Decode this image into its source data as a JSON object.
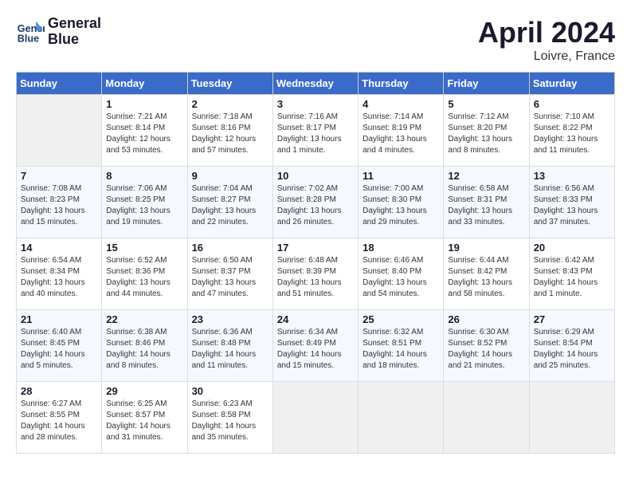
{
  "logo": {
    "line1": "General",
    "line2": "Blue"
  },
  "title": "April 2024",
  "location": "Loivre, France",
  "days_of_week": [
    "Sunday",
    "Monday",
    "Tuesday",
    "Wednesday",
    "Thursday",
    "Friday",
    "Saturday"
  ],
  "weeks": [
    [
      {
        "num": "",
        "empty": true
      },
      {
        "num": "1",
        "sunrise": "7:21 AM",
        "sunset": "8:14 PM",
        "daylight": "12 hours and 53 minutes."
      },
      {
        "num": "2",
        "sunrise": "7:18 AM",
        "sunset": "8:16 PM",
        "daylight": "12 hours and 57 minutes."
      },
      {
        "num": "3",
        "sunrise": "7:16 AM",
        "sunset": "8:17 PM",
        "daylight": "13 hours and 1 minute."
      },
      {
        "num": "4",
        "sunrise": "7:14 AM",
        "sunset": "8:19 PM",
        "daylight": "13 hours and 4 minutes."
      },
      {
        "num": "5",
        "sunrise": "7:12 AM",
        "sunset": "8:20 PM",
        "daylight": "13 hours and 8 minutes."
      },
      {
        "num": "6",
        "sunrise": "7:10 AM",
        "sunset": "8:22 PM",
        "daylight": "13 hours and 11 minutes."
      }
    ],
    [
      {
        "num": "7",
        "sunrise": "7:08 AM",
        "sunset": "8:23 PM",
        "daylight": "13 hours and 15 minutes."
      },
      {
        "num": "8",
        "sunrise": "7:06 AM",
        "sunset": "8:25 PM",
        "daylight": "13 hours and 19 minutes."
      },
      {
        "num": "9",
        "sunrise": "7:04 AM",
        "sunset": "8:27 PM",
        "daylight": "13 hours and 22 minutes."
      },
      {
        "num": "10",
        "sunrise": "7:02 AM",
        "sunset": "8:28 PM",
        "daylight": "13 hours and 26 minutes."
      },
      {
        "num": "11",
        "sunrise": "7:00 AM",
        "sunset": "8:30 PM",
        "daylight": "13 hours and 29 minutes."
      },
      {
        "num": "12",
        "sunrise": "6:58 AM",
        "sunset": "8:31 PM",
        "daylight": "13 hours and 33 minutes."
      },
      {
        "num": "13",
        "sunrise": "6:56 AM",
        "sunset": "8:33 PM",
        "daylight": "13 hours and 37 minutes."
      }
    ],
    [
      {
        "num": "14",
        "sunrise": "6:54 AM",
        "sunset": "8:34 PM",
        "daylight": "13 hours and 40 minutes."
      },
      {
        "num": "15",
        "sunrise": "6:52 AM",
        "sunset": "8:36 PM",
        "daylight": "13 hours and 44 minutes."
      },
      {
        "num": "16",
        "sunrise": "6:50 AM",
        "sunset": "8:37 PM",
        "daylight": "13 hours and 47 minutes."
      },
      {
        "num": "17",
        "sunrise": "6:48 AM",
        "sunset": "8:39 PM",
        "daylight": "13 hours and 51 minutes."
      },
      {
        "num": "18",
        "sunrise": "6:46 AM",
        "sunset": "8:40 PM",
        "daylight": "13 hours and 54 minutes."
      },
      {
        "num": "19",
        "sunrise": "6:44 AM",
        "sunset": "8:42 PM",
        "daylight": "13 hours and 58 minutes."
      },
      {
        "num": "20",
        "sunrise": "6:42 AM",
        "sunset": "8:43 PM",
        "daylight": "14 hours and 1 minute."
      }
    ],
    [
      {
        "num": "21",
        "sunrise": "6:40 AM",
        "sunset": "8:45 PM",
        "daylight": "14 hours and 5 minutes."
      },
      {
        "num": "22",
        "sunrise": "6:38 AM",
        "sunset": "8:46 PM",
        "daylight": "14 hours and 8 minutes."
      },
      {
        "num": "23",
        "sunrise": "6:36 AM",
        "sunset": "8:48 PM",
        "daylight": "14 hours and 11 minutes."
      },
      {
        "num": "24",
        "sunrise": "6:34 AM",
        "sunset": "8:49 PM",
        "daylight": "14 hours and 15 minutes."
      },
      {
        "num": "25",
        "sunrise": "6:32 AM",
        "sunset": "8:51 PM",
        "daylight": "14 hours and 18 minutes."
      },
      {
        "num": "26",
        "sunrise": "6:30 AM",
        "sunset": "8:52 PM",
        "daylight": "14 hours and 21 minutes."
      },
      {
        "num": "27",
        "sunrise": "6:29 AM",
        "sunset": "8:54 PM",
        "daylight": "14 hours and 25 minutes."
      }
    ],
    [
      {
        "num": "28",
        "sunrise": "6:27 AM",
        "sunset": "8:55 PM",
        "daylight": "14 hours and 28 minutes."
      },
      {
        "num": "29",
        "sunrise": "6:25 AM",
        "sunset": "8:57 PM",
        "daylight": "14 hours and 31 minutes."
      },
      {
        "num": "30",
        "sunrise": "6:23 AM",
        "sunset": "8:58 PM",
        "daylight": "14 hours and 35 minutes."
      },
      {
        "num": "",
        "empty": true
      },
      {
        "num": "",
        "empty": true
      },
      {
        "num": "",
        "empty": true
      },
      {
        "num": "",
        "empty": true
      }
    ]
  ]
}
